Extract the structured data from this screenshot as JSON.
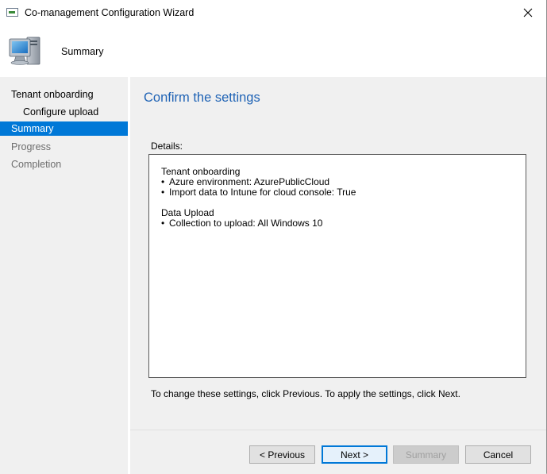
{
  "window": {
    "title": "Co-management Configuration Wizard"
  },
  "header": {
    "title": "Summary",
    "icon": "computer-monitor-icon"
  },
  "sidebar": {
    "items": [
      {
        "label": "Tenant onboarding",
        "state": "normal"
      },
      {
        "label": "Configure upload",
        "state": "normal"
      },
      {
        "label": "Summary",
        "state": "active"
      },
      {
        "label": "Progress",
        "state": "dim"
      },
      {
        "label": "Completion",
        "state": "dim"
      }
    ]
  },
  "content": {
    "title": "Confirm the settings",
    "details_label": "Details:",
    "sections": [
      {
        "heading": "Tenant onboarding",
        "bullets": [
          "Azure environment: AzurePublicCloud",
          "Import data to Intune for cloud console: True"
        ]
      },
      {
        "heading": "Data Upload",
        "bullets": [
          "Collection to upload: All Windows 10"
        ]
      }
    ],
    "footer_note": "To change these settings, click Previous. To apply the settings, click Next."
  },
  "buttons": {
    "previous": "< Previous",
    "next": "Next >",
    "summary": "Summary",
    "cancel": "Cancel"
  },
  "colors": {
    "accent": "#0078d7",
    "title_blue": "#1f63b5",
    "panel_bg": "#f0f0f0"
  }
}
